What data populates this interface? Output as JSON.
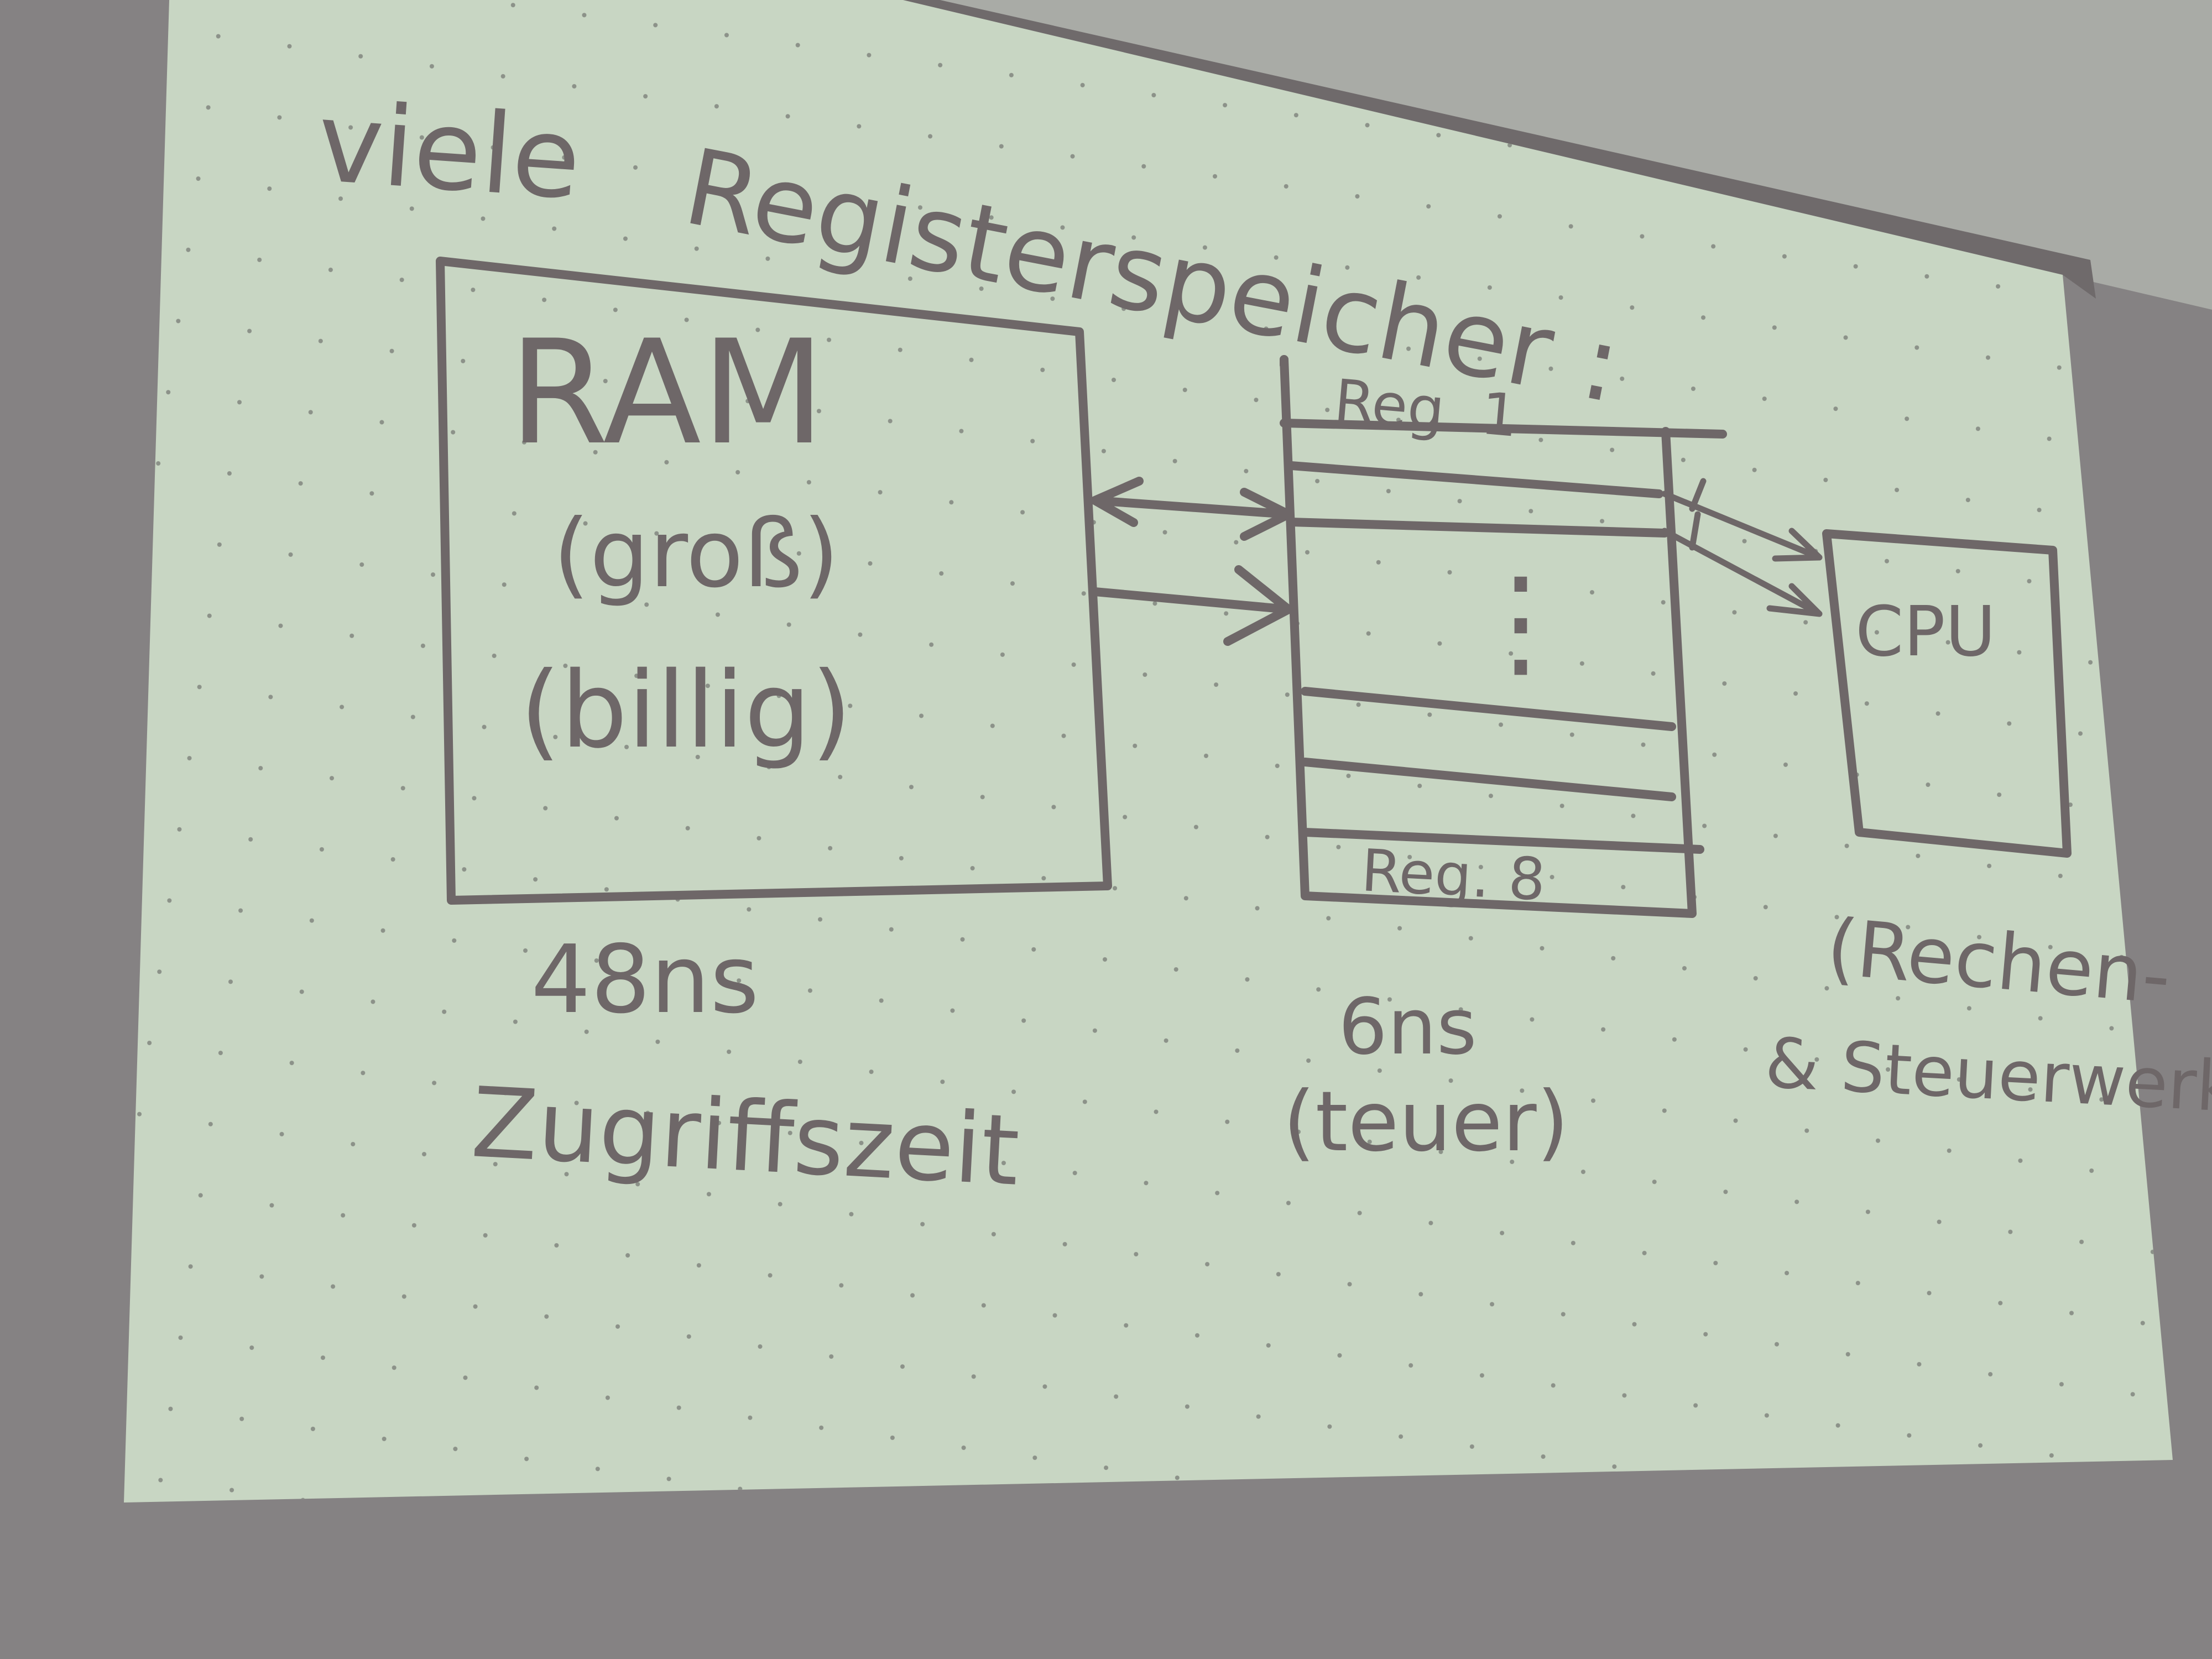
{
  "colors": {
    "projection": "#c8d6c3",
    "ink": "#6e6768",
    "wall": "#858283",
    "ceiling": "#a9aba6"
  },
  "heading": {
    "line1": "viele",
    "line2": "Registerspeicher :"
  },
  "ram": {
    "label": "RAM",
    "size_note": "(groß)",
    "cost_note": "(billig)",
    "access_time": "48ns",
    "access_time_label": "Zugriffszeit"
  },
  "registers": {
    "first": "Reg. 1",
    "dots": "⋮",
    "last": "Reg. 8",
    "access_time": "6ns",
    "cost_note": "(teuer)"
  },
  "cpu": {
    "label": "CPU",
    "note_line1": "(Rechen-",
    "note_line2": "& Steuerwerk)"
  }
}
